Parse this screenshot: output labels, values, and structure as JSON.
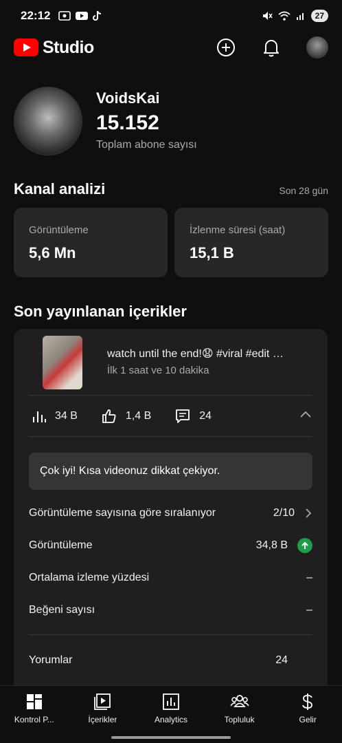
{
  "status_bar": {
    "time": "22:12",
    "battery": "27"
  },
  "header": {
    "brand": "Studio"
  },
  "channel": {
    "name": "VoidsKai",
    "subscribers": "15.152",
    "subscribers_label": "Toplam abone sayısı"
  },
  "analytics": {
    "title": "Kanal analizi",
    "period": "Son 28 gün",
    "cards": [
      {
        "label": "Görüntüleme",
        "value": "5,6 Mn"
      },
      {
        "label": "İzlenme süresi (saat)",
        "value": "15,1 B"
      }
    ]
  },
  "recent": {
    "title": "Son yayınlanan içerikler",
    "video": {
      "title": "watch until the end!😧 #viral #edit …",
      "age": "İlk 1 saat ve 10 dakika",
      "views": "34 B",
      "likes": "1,4 B",
      "comments": "24"
    },
    "banner": "Çok iyi! Kısa videonuz dikkat çekiyor.",
    "rows": [
      {
        "label": "Görüntüleme sayısına göre sıralanıyor",
        "value": "2/10"
      },
      {
        "label": "Görüntüleme",
        "value": "34,8 B"
      },
      {
        "label": "Ortalama izleme yüzdesi",
        "value": "–"
      },
      {
        "label": "Beğeni sayısı",
        "value": "–"
      },
      {
        "label": "Yorumlar",
        "value": "24"
      }
    ]
  },
  "nav": [
    {
      "label": "Kontrol P...",
      "icon": "dashboard-icon"
    },
    {
      "label": "İçerikler",
      "icon": "content-icon"
    },
    {
      "label": "Analytics",
      "icon": "analytics-icon"
    },
    {
      "label": "Topluluk",
      "icon": "community-icon"
    },
    {
      "label": "Gelir",
      "icon": "earn-icon"
    }
  ]
}
